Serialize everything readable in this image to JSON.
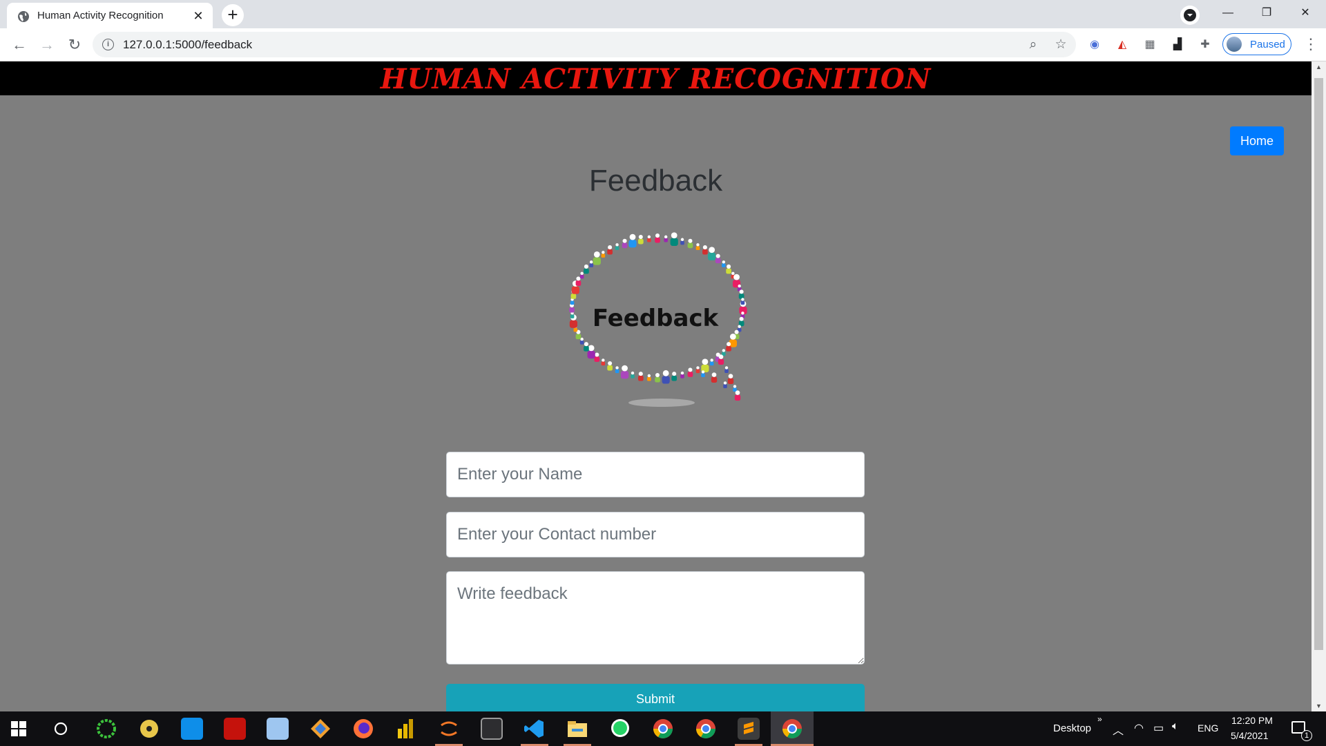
{
  "browser": {
    "tab_title": "Human Activity Recognition",
    "url": "127.0.0.1:5000/feedback",
    "profile_label": "Paused"
  },
  "page": {
    "banner_title": "HUMAN ACTIVITY RECOGNITION",
    "home_label": "Home",
    "heading": "Feedback",
    "graphic_text": "Feedback",
    "form": {
      "name_placeholder": "Enter your Name",
      "contact_placeholder": "Enter your Contact number",
      "feedback_placeholder": "Write feedback",
      "submit_label": "Submit"
    }
  },
  "taskbar": {
    "desktop_label": "Desktop",
    "language": "ENG",
    "time": "12:20 PM",
    "date": "5/4/2021",
    "notification_count": "1"
  },
  "colors": {
    "banner_text": "#e8170f",
    "home_button": "#007bff",
    "submit_button": "#17a2b8",
    "page_background": "#7e7e7e"
  }
}
